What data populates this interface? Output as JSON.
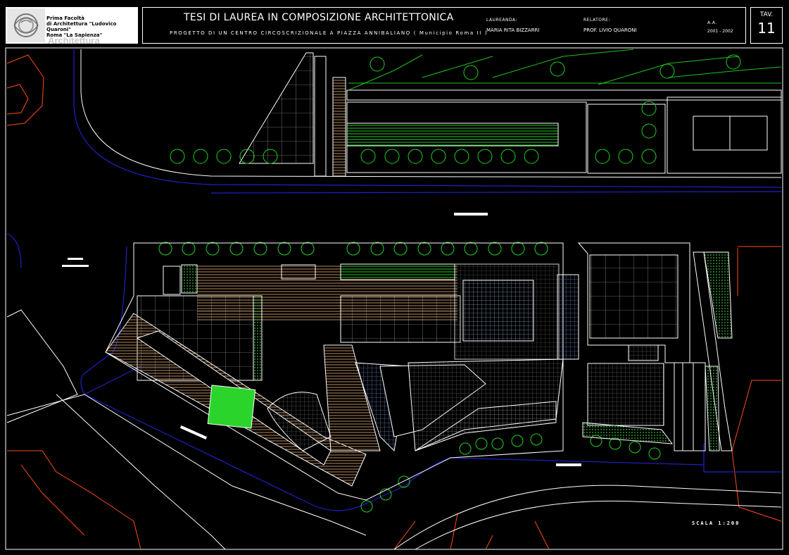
{
  "logo": {
    "line1": "Prima Facoltà",
    "line2": "di Architettura \"Ludovico Quaroni\"",
    "line3": "Roma \"La Sapienza\"",
    "watermark": "Architettura"
  },
  "title_block": {
    "title": "TESI DI LAUREA IN COMPOSIZIONE ARCHITETTONICA",
    "subtitle": "PROGETTO  DI  UN  CENTRO  CIRCOSCRIZIONALE  A  PIAZZA  ANNIBALIANO  ( Municipio Roma II )",
    "laureanda_label": "LAUREANDA:",
    "laureanda_value": "MARIA RITA BIZZARRI",
    "relatore_label": "RELATORE:",
    "relatore_value": "PROF. LIVIO QUARONI",
    "aa_label": "A.A.",
    "aa_value": "2001 - 2002",
    "tav_label": "TAV.",
    "tav_value": "11"
  },
  "scale_label": "SCALA 1:200",
  "colors": {
    "background": "#000000",
    "building_lines": "#ffffff",
    "road_edge": "#2020c8",
    "context_buildings": "#ff4a1a",
    "trees": "#00c800",
    "paving": "#c89a6a",
    "water_blue": "#5a78b4"
  }
}
